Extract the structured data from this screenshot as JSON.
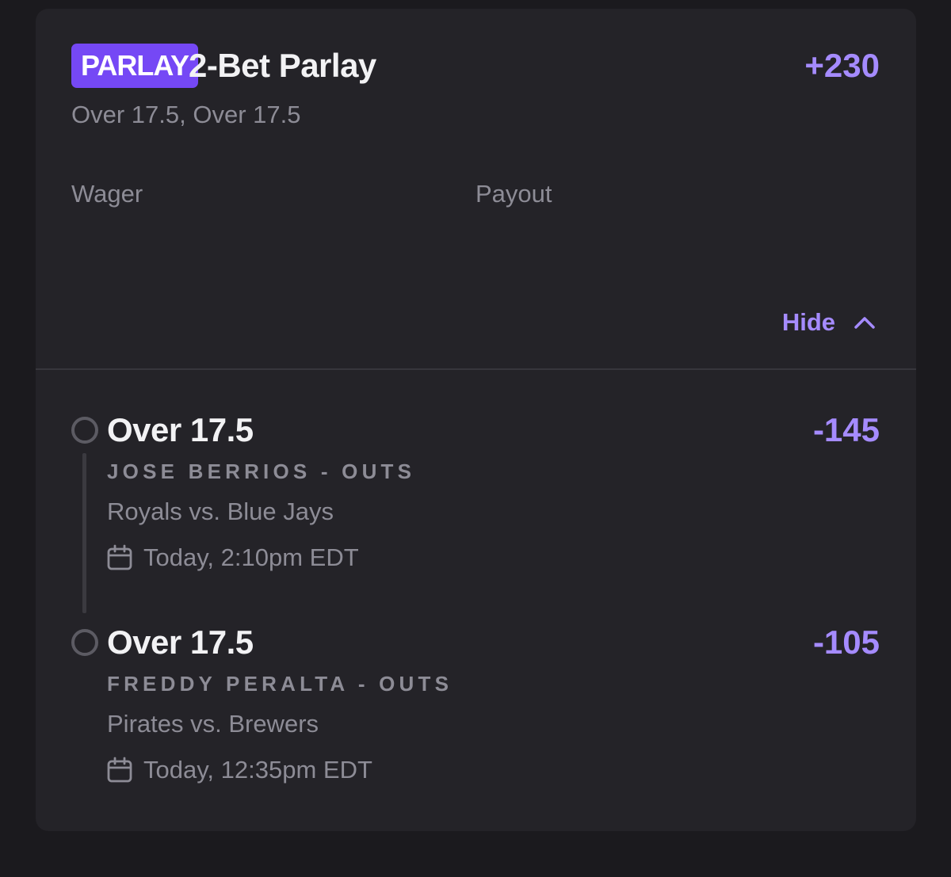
{
  "bet": {
    "badge": "PARLAY",
    "title": "2-Bet Parlay",
    "odds": "+230",
    "summary": "Over 17.5, Over 17.5",
    "wager_label": "Wager",
    "payout_label": "Payout",
    "toggle_label": "Hide"
  },
  "legs": [
    {
      "selection": "Over 17.5",
      "odds": "-145",
      "market": "JOSE BERRIOS - OUTS",
      "matchup": "Royals vs. Blue Jays",
      "time": "Today, 2:10pm EDT"
    },
    {
      "selection": "Over 17.5",
      "odds": "-105",
      "market": "FREDDY PERALTA - OUTS",
      "matchup": "Pirates vs. Brewers",
      "time": "Today, 12:35pm EDT"
    }
  ],
  "icons": {
    "toggle": "chevron-up-icon",
    "time": "calendar-icon",
    "leg_status": "radio-circle-icon"
  },
  "colors": {
    "accent": "#a58bff",
    "badge_bg": "#7548f5",
    "card_bg": "#242328",
    "page_bg": "#1b1a1e"
  }
}
